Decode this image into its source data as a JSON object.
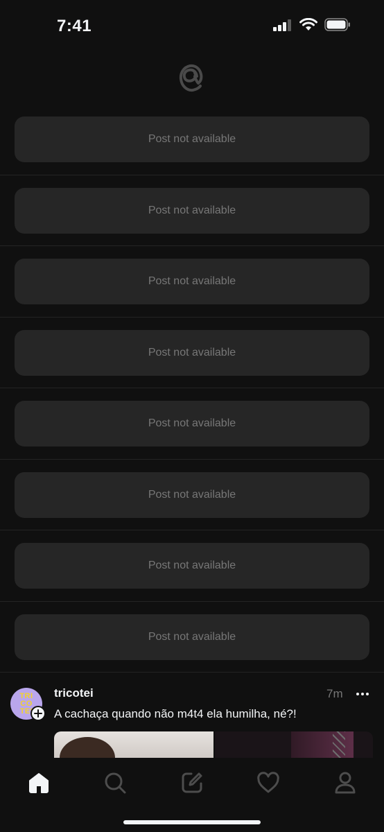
{
  "status_bar": {
    "time": "7:41"
  },
  "feed": {
    "unavailable_posts": [
      {
        "label": "Post not available"
      },
      {
        "label": "Post not available"
      },
      {
        "label": "Post not available"
      },
      {
        "label": "Post not available"
      },
      {
        "label": "Post not available"
      },
      {
        "label": "Post not available"
      },
      {
        "label": "Post not available"
      },
      {
        "label": "Post not available"
      }
    ],
    "post": {
      "username": "tricotei",
      "avatar_text_line1": "TRI",
      "avatar_text_line2": "CO",
      "avatar_text_line3": "TEI",
      "timestamp": "7m",
      "text": "A cachaça quando não m4t4 ela humilha, né?!"
    }
  },
  "tabbar": {
    "items": [
      {
        "icon": "home-icon",
        "active": true
      },
      {
        "icon": "search-icon",
        "active": false
      },
      {
        "icon": "compose-icon",
        "active": false
      },
      {
        "icon": "heart-icon",
        "active": false
      },
      {
        "icon": "profile-icon",
        "active": false
      }
    ]
  },
  "colors": {
    "background": "#101010",
    "card": "#262626",
    "muted_text": "#777777",
    "primary_text": "#f3f5f7",
    "inactive_icon": "#4d4d4d"
  }
}
